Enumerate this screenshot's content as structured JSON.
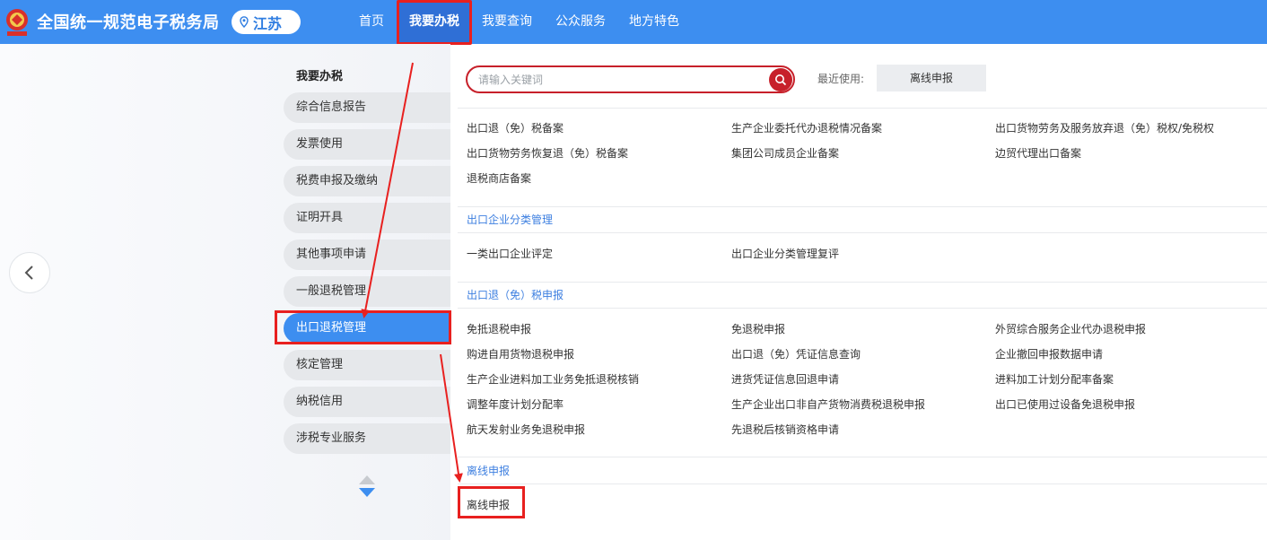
{
  "header": {
    "site_title": "全国统一规范电子税务局",
    "region": "江苏",
    "nav": [
      "首页",
      "我要办税",
      "我要查询",
      "公众服务",
      "地方特色"
    ]
  },
  "sidebar": {
    "title": "我要办税",
    "items": [
      "综合信息报告",
      "发票使用",
      "税费申报及缴纳",
      "证明开具",
      "其他事项申请",
      "一般退税管理",
      "出口退税管理",
      "核定管理",
      "纳税信用",
      "涉税专业服务"
    ]
  },
  "search": {
    "placeholder": "请输入关键词"
  },
  "recent": {
    "label": "最近使用:",
    "item": "离线申报"
  },
  "sections": {
    "top_links": [
      "出口退（免）税备案",
      "生产企业委托代办退税情况备案",
      "出口货物劳务及服务放弃退（免）税权/免税权",
      "出口货物劳务恢复退（免）税备案",
      "集团公司成员企业备案",
      "边贸代理出口备案",
      "退税商店备案"
    ],
    "classification": {
      "title": "出口企业分类管理",
      "links": [
        "一类出口企业评定",
        "出口企业分类管理复评"
      ]
    },
    "declaration": {
      "title": "出口退（免）税申报",
      "links": [
        "免抵退税申报",
        "免退税申报",
        "外贸综合服务企业代办退税申报",
        "购进自用货物退税申报",
        "出口退（免）凭证信息查询",
        "企业撤回申报数据申请",
        "生产企业进料加工业务免抵退税核销",
        "进货凭证信息回退申请",
        "进料加工计划分配率备案",
        "调整年度计划分配率",
        "生产企业出口非自产货物消费税退税申报",
        "出口已使用过设备免退税申报",
        "航天发射业务免退税申报",
        "先退税后核销资格申请"
      ]
    },
    "offline": {
      "title": "离线申报",
      "links": [
        "离线申报"
      ]
    }
  },
  "colors": {
    "primary": "#3d8ef0",
    "accent_red": "#c7202a",
    "annotation": "#e8201f"
  }
}
